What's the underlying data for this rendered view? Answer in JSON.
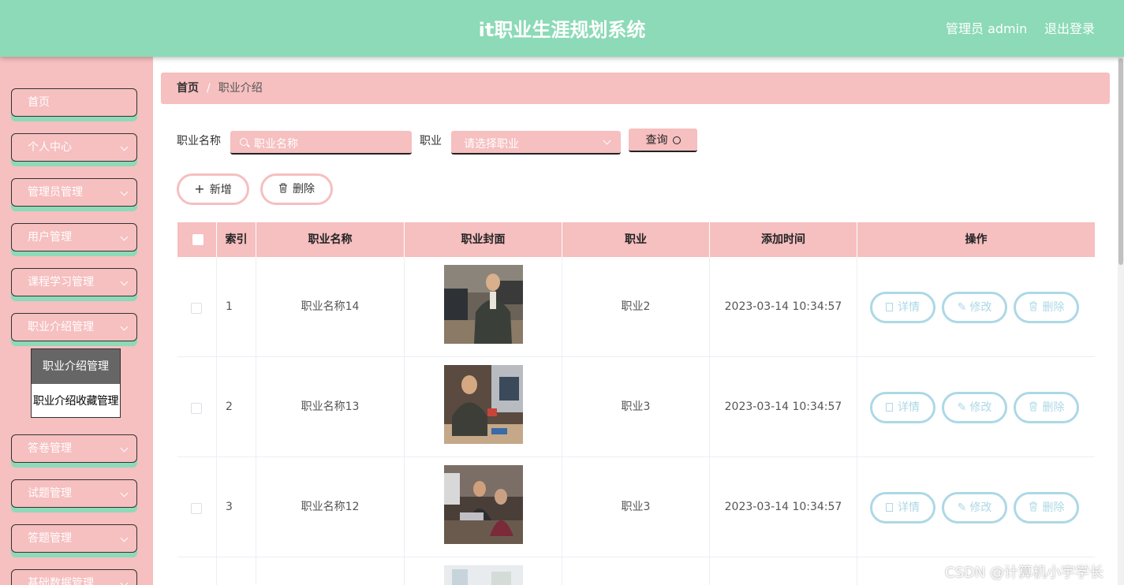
{
  "header": {
    "title": "it职业生涯规划系统",
    "user": "管理员 admin",
    "logout": "退出登录"
  },
  "sidebar": {
    "items": [
      {
        "label": "首页"
      },
      {
        "label": "个人中心"
      },
      {
        "label": "管理员管理"
      },
      {
        "label": "用户管理"
      },
      {
        "label": "课程学习管理"
      },
      {
        "label": "职业介绍管理"
      },
      {
        "label": "答卷管理"
      },
      {
        "label": "试题管理"
      },
      {
        "label": "答题管理"
      },
      {
        "label": "基础数据管理"
      }
    ],
    "submenu": [
      {
        "label": "职业介绍管理"
      },
      {
        "label": "职业介绍收藏管理"
      }
    ]
  },
  "breadcrumb": {
    "home": "首页",
    "sep": "/",
    "current": "职业介绍"
  },
  "search": {
    "name_label": "职业名称",
    "name_placeholder": "职业名称",
    "job_label": "职业",
    "job_placeholder": "请选择职业",
    "query_button": "查询"
  },
  "actions": {
    "add": "新增",
    "delete": "删除"
  },
  "table": {
    "headers": [
      "索引",
      "职业名称",
      "职业封面",
      "职业",
      "添加时间",
      "操作"
    ],
    "row_actions": {
      "detail": "详情",
      "edit": "修改",
      "delete": "删除"
    },
    "rows": [
      {
        "index": "1",
        "name": "职业名称14",
        "job": "职业2",
        "time": "2023-03-14 10:34:57"
      },
      {
        "index": "2",
        "name": "职业名称13",
        "job": "职业3",
        "time": "2023-03-14 10:34:57"
      },
      {
        "index": "3",
        "name": "职业名称12",
        "job": "职业3",
        "time": "2023-03-14 10:34:57"
      }
    ]
  },
  "watermark": "CSDN @计算机小宇学长",
  "colors": {
    "header": "#8cdab7",
    "pink": "#f6bfc0",
    "action_border": "#add8e6"
  }
}
